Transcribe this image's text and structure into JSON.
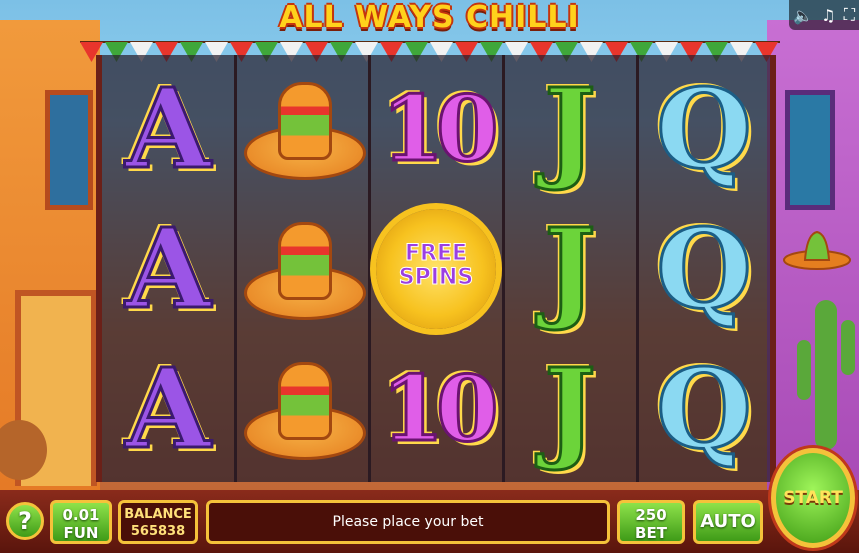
{
  "game": {
    "title": "ALL WAYS CHILLI"
  },
  "top_controls": {
    "sound_icon": "speaker-icon",
    "music_icon": "music-note-icon",
    "fullscreen_icon": "fullscreen-icon"
  },
  "reels": [
    [
      "A",
      "A",
      "A"
    ],
    [
      "sombrero",
      "sombrero",
      "sombrero"
    ],
    [
      "10",
      "FREE SPINS",
      "10"
    ],
    [
      "J",
      "J",
      "J"
    ],
    [
      "Q",
      "Q",
      "Q"
    ]
  ],
  "free_spins_symbol": {
    "line1": "FREE",
    "line2": "SPINS"
  },
  "bottom_bar": {
    "help_label": "?",
    "coin_value": "0.01",
    "coin_label": "FUN",
    "balance_label": "BALANCE",
    "balance_value": "565838",
    "message": "Please place your bet",
    "bet_value": "250",
    "bet_label": "BET",
    "auto_label": "AUTO",
    "start_label": "START"
  },
  "colors": {
    "accent_gold": "#f5c23a",
    "button_green": "#3f9b18",
    "bar_dark_red": "#5a150c"
  }
}
